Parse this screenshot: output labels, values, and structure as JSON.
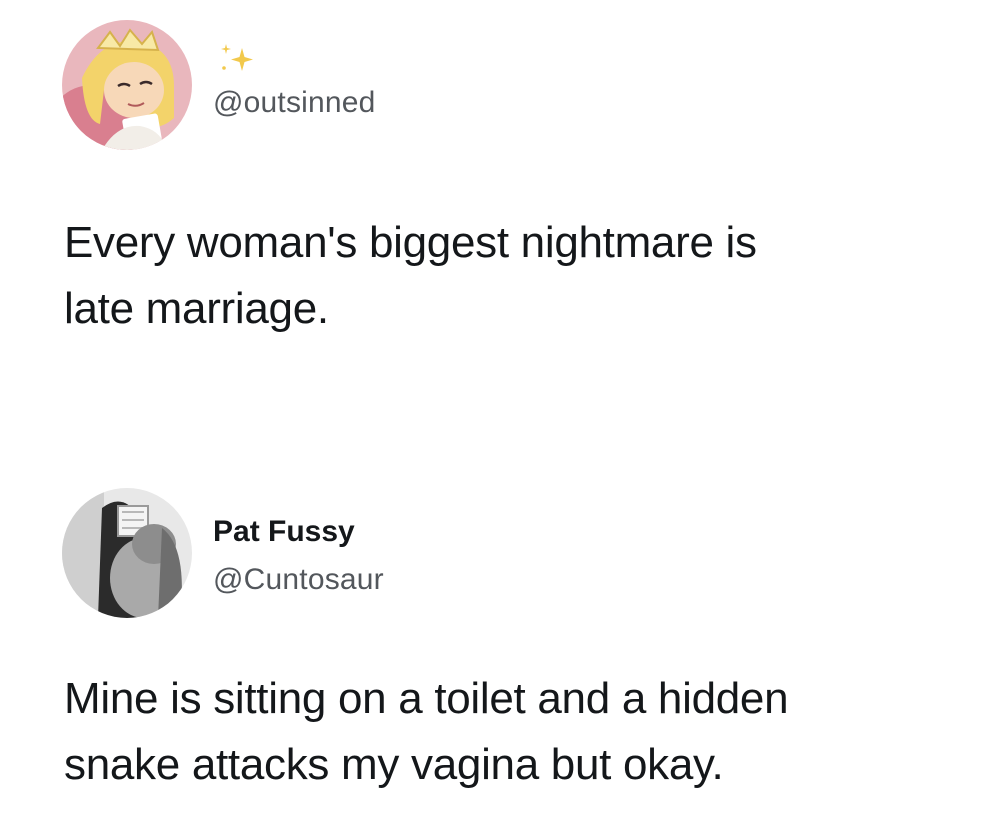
{
  "tweets": [
    {
      "avatar_icon": "cartoon-princess-avatar",
      "sparkle_icon": "sparkle-icon",
      "handle": "@outsinned",
      "text_lines": [
        "Every woman's biggest nightmare is",
        "late marriage."
      ]
    },
    {
      "avatar_icon": "grayscale-photo-avatar",
      "display_name": "Pat Fussy",
      "handle": "@Cuntosaur",
      "text_lines": [
        "Mine is sitting on a toilet and a hidden",
        "snake attacks my vagina but okay."
      ]
    }
  ],
  "colors": {
    "text": "#14171a",
    "handle": "#53575c",
    "sparkle": "#f2c94c",
    "background": "#ffffff"
  }
}
